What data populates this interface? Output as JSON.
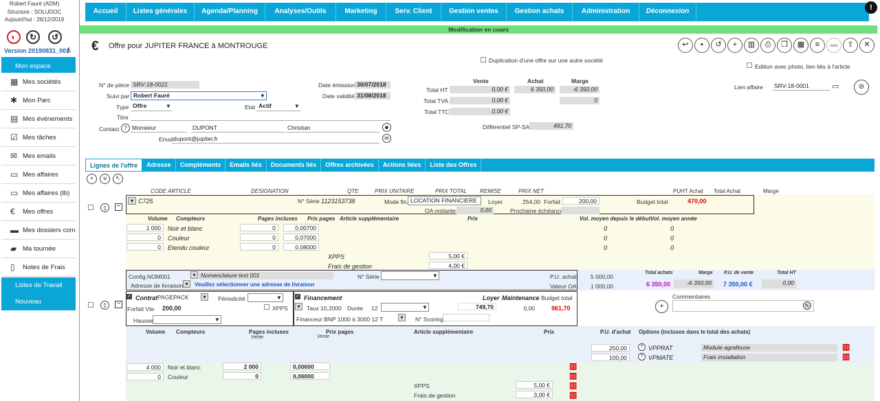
{
  "sidebar": {
    "user": "Robert Fauré (ADM)",
    "structure": "Structure : SOLUDOC",
    "today": "Aujourd'hui : 26/12/2019",
    "version": "Version 20190831_001",
    "items": [
      {
        "label": "Mon espace"
      },
      {
        "label": "Mes sociétés",
        "icon": "building-icon"
      },
      {
        "label": "Mon Parc",
        "icon": "puzzle-icon"
      },
      {
        "label": "Mes événements",
        "icon": "calendar-icon"
      },
      {
        "label": "Mes tâches",
        "icon": "checklist-icon"
      },
      {
        "label": "Mes emails",
        "icon": "envelope-icon"
      },
      {
        "label": "Mes affaires",
        "icon": "briefcase-icon"
      },
      {
        "label": "Mes affaires (tb)",
        "icon": "briefcase-icon"
      },
      {
        "label": "Mes offres",
        "icon": "euro-icon"
      },
      {
        "label": "Mes dossiers com",
        "icon": "truck-icon"
      },
      {
        "label": "Ma tournée",
        "icon": "car-icon"
      },
      {
        "label": "Notes de Frais",
        "icon": "receipt-icon"
      },
      {
        "label": "Listes de Travail"
      },
      {
        "label": "Nouveau"
      }
    ]
  },
  "nav": [
    "Accueil",
    "Listes générales",
    "Agenda/Planning",
    "Analyses/Outils",
    "Marketing",
    "Serv. Client",
    "Gestion ventes",
    "Gestion achats",
    "Administration",
    "Déconnexion"
  ],
  "notice": "Modification en cours",
  "page": {
    "title": "Offre pour JUPITER FRANCE à MONTROUGE",
    "duplication": "Duplication d'une offre sur une autre société",
    "edition": "Edition avec photo, lien liés à l'article"
  },
  "form": {
    "piece_label": "N° de pièce",
    "piece": "SRV-18-0021",
    "suivi_label": "Suivi par",
    "suivi": "Robert Fauré",
    "type_label": "Type",
    "type": "Offre",
    "etat_label": "Etat",
    "etat": "Actif",
    "titre_label": "Titre",
    "contact_label": "Contact",
    "civilite": "Monsieur",
    "nom": "DUPONT",
    "prenom": "Christian",
    "email_label": "Email",
    "email": "dupont@jupiter.fr",
    "emission_label": "Date émission",
    "emission": "30/07/2018",
    "validite_label": "Date validité",
    "validite": "31/08/2018",
    "lien_label": "Lien affaire",
    "lien": "SRV-18-0001"
  },
  "totals": {
    "h_vente": "Vente",
    "h_achat": "Achat",
    "h_marge": "Marge",
    "ht_label": "Total HT",
    "ht_vente": "0,00 €",
    "ht_achat": "6 350,00",
    "ht_marge": "-6 350,00",
    "tva_label": "Total TVA",
    "tva_vente": "0,00 €",
    "tva_marge": "0",
    "ttc_label": "Total TTC",
    "ttc_vente": "0,00 €",
    "diff_label": "Différentiel SP-SA",
    "diff": "491,70"
  },
  "tabs": [
    "Lignes de l'offre",
    "Adresse",
    "Compléments",
    "Emails liés",
    "Documents liés",
    "Offres archivées",
    "Actions liées",
    "Liste des Offres"
  ],
  "cols": {
    "code": "CODE ARTICLE",
    "designation": "DESIGNATION",
    "qte": "QTE",
    "pu": "PRIX UNITAIRE",
    "pt": "PRIX TOTAL",
    "remise": "REMISE",
    "pn": "PRIX NET",
    "puht": "PUHT Achat",
    "ta": "Total Achat",
    "marge": "Marge"
  },
  "l1": {
    "code": "C725",
    "serie_label": "N° Série",
    "serie": "1123153738",
    "mode_label": "Mode fin.",
    "mode": "LOCATION FINANCIERE",
    "loyer_label": "Loyer",
    "loyer": "254,00",
    "forfait_label": "Forfait",
    "forfait": "200,00",
    "budget_label": "Budget total",
    "budget": "470,00",
    "oa_label": "OA restante",
    "oa": "0,00",
    "ech_label": "Prochaine échéance :",
    "h": {
      "vol": "Volume",
      "cpt": "Compteurs",
      "pi": "Pages incluses",
      "pp": "Prix pages",
      "art": "Article supplémentaire",
      "px": "Prix",
      "vd": "Vol. moyen depuis le début",
      "va": "Vol. moyen année"
    },
    "rows": [
      {
        "vol": "1 000",
        "cpt": "Noir et blanc",
        "pi": "0",
        "pp": "0,00700",
        "vd": "0",
        "va": "0"
      },
      {
        "vol": "0",
        "cpt": "Couleur",
        "pi": "0",
        "pp": "0,07000",
        "vd": "0",
        "va": "0"
      },
      {
        "vol": "0",
        "cpt": "Etendu couleur",
        "pi": "0",
        "pp": "0,08000",
        "vd": "0",
        "va": "0"
      }
    ],
    "xpps_label": "XPPS",
    "xpps": "5,00 €",
    "frais_label": "Frais de gestion",
    "frais": "4,00 €"
  },
  "l2": {
    "config_label": "Config.",
    "config": "NOM001",
    "nomen": "Nomenclature test 001",
    "serie_label": "N° Série",
    "pua_label": "P.U. achat",
    "pua": "5 000,00",
    "adr_label": "Adresse de livraison",
    "adr_msg": "Veuillez sélectionner une adresse de livraison",
    "voa_label": "Valeur OA",
    "voa": "1 000,00",
    "h_ta": "Total achats",
    "h_m": "Marge",
    "h_pv": "P.U. de vente",
    "h_th": "Total HT",
    "ta": "6 350,00",
    "m": "-6 350,00",
    "pv": "7 350,00 €",
    "th": "0,00",
    "contrat_label": "Contrat",
    "contrat": "PAGEPACK",
    "period_label": "Périodicité",
    "forfait_label": "Forfait Vte",
    "forfait": "200,00",
    "xpps_label": "XPPS",
    "hausse_label": "Hausse",
    "fin_label": "Financement",
    "taux_label": "Taux",
    "taux": "10,2000",
    "duree_label": "Durée",
    "duree": "12",
    "financeur_label": "Financeur",
    "financeur": "BNP 1000 à 3000 12 T",
    "scoring_label": "N° Scoring",
    "loyer_label": "Loyer",
    "loyer": "749,70",
    "maint_label": "Maintenance",
    "maint": "0,00",
    "budget_label": "Budget total",
    "budget": "961,70",
    "comment_label": "Commentaires",
    "h": {
      "vol": "Volume",
      "cpt": "Compteurs",
      "pi": "Pages incluses",
      "vente": "Vente",
      "pp": "Prix pages",
      "art": "Article supplémentaire",
      "px": "Prix",
      "pua": "P.U. d'achat",
      "opt": "Options (incluses dans le total des achats)"
    },
    "opts": [
      {
        "pu": "250,00",
        "code": "VPPRAT",
        "desc": "Module agrafeuse"
      },
      {
        "pu": "100,00",
        "code": "VPMATE",
        "desc": "Frais installation"
      }
    ],
    "rows": [
      {
        "vol": "4 000",
        "cpt": "Noir et blanc",
        "pi": "2 000",
        "pp": "0,00600"
      },
      {
        "vol": "0",
        "cpt": "Couleur",
        "pi": "0",
        "pp": "0,06000"
      }
    ],
    "xpps_label2": "XPPS",
    "xpps": "5,00 €",
    "frais_label": "Frais de gestion",
    "frais": "3,00 €"
  }
}
